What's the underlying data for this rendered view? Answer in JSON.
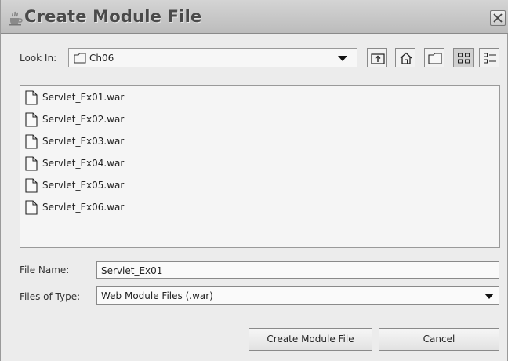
{
  "window": {
    "title": "Create Module File"
  },
  "look_in": {
    "label": "Look In:",
    "value": "Ch06"
  },
  "toolbar_icons": [
    "up-folder-icon",
    "home-icon",
    "new-folder-icon",
    "list-view-icon",
    "details-view-icon"
  ],
  "files": [
    {
      "name": "Servlet_Ex01.war"
    },
    {
      "name": "Servlet_Ex02.war"
    },
    {
      "name": "Servlet_Ex03.war"
    },
    {
      "name": "Servlet_Ex04.war"
    },
    {
      "name": "Servlet_Ex05.war"
    },
    {
      "name": "Servlet_Ex06.war"
    }
  ],
  "file_name": {
    "label": "File Name:",
    "value": "Servlet_Ex01"
  },
  "files_of_type": {
    "label": "Files of Type:",
    "value": "Web Module Files (.war)"
  },
  "buttons": {
    "create": "Create Module File",
    "cancel": "Cancel"
  }
}
